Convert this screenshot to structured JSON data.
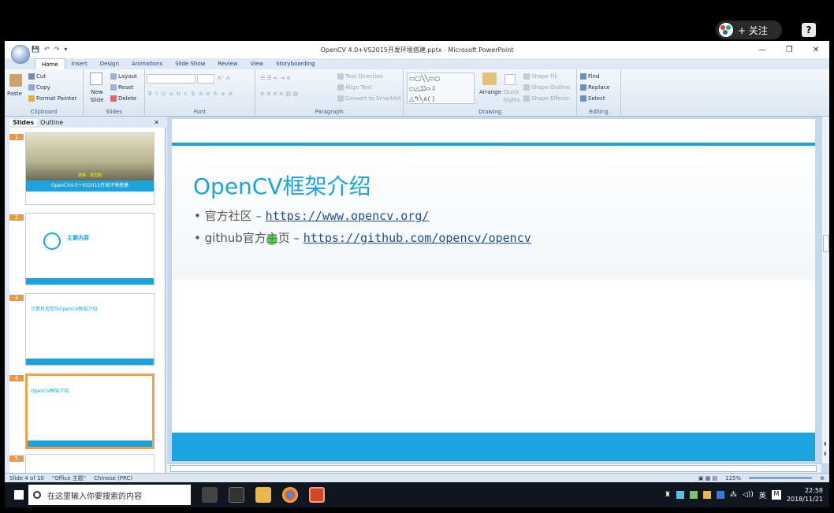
{
  "overlay": {
    "follow_label": "+ 关注",
    "help_label": "?"
  },
  "window": {
    "title": "OpenCV 4.0+VS2015开发环境搭建.pptx - Microsoft PowerPoint",
    "qat": [
      "💾",
      "↶",
      "↷",
      "▾"
    ],
    "min": "—",
    "max": "❐",
    "close": "✕"
  },
  "tabs": [
    "Home",
    "Insert",
    "Design",
    "Animations",
    "Slide Show",
    "Review",
    "View",
    "Storyboarding"
  ],
  "ribbon": {
    "clipboard": {
      "label": "Clipboard",
      "paste": "Paste",
      "cut": "Cut",
      "copy": "Copy",
      "format_painter": "Format Painter"
    },
    "slides": {
      "label": "Slides",
      "new_slide": "New Slide",
      "layout": "Layout",
      "reset": "Reset",
      "delete": "Delete"
    },
    "font": {
      "label": "Font",
      "buttons": [
        "B",
        "I",
        "U",
        "abc",
        "S",
        "AV",
        "Aa",
        "A"
      ]
    },
    "paragraph": {
      "label": "Paragraph",
      "text_direction": "Text Direction",
      "align_text": "Align Text",
      "convert_smartart": "Convert to SmartArt"
    },
    "drawing": {
      "label": "Drawing",
      "arrange": "Arrange",
      "quick_styles": "Quick Styles",
      "shape_fill": "Shape Fill",
      "shape_outline": "Shape Outline",
      "shape_effects": "Shape Effects"
    },
    "editing": {
      "label": "Editing",
      "find": "Find",
      "replace": "Replace",
      "select": "Select"
    }
  },
  "slidepane": {
    "tab_slides": "Slides",
    "tab_outline": "Outline",
    "close": "✕",
    "thumbs": [
      {
        "num": "1",
        "text": "OpenCV4.0+VS2015开发环境搭建",
        "sub": "讲师：贾志刚"
      },
      {
        "num": "2",
        "text": "主要内容"
      },
      {
        "num": "3",
        "text": "计算机视觉与OpenCV框架介绍"
      },
      {
        "num": "4",
        "text": "OpenCV框架介绍"
      },
      {
        "num": "5",
        "text": ""
      }
    ]
  },
  "slide": {
    "title": "OpenCV框架介绍",
    "bullets": [
      {
        "label": "官方社区 – ",
        "link": "https://www.opencv.org/"
      },
      {
        "label": "github官方主页 – ",
        "link": "https://github.com/opencv/opencv"
      }
    ],
    "accent": "#1aa3dc"
  },
  "status": {
    "slide": "Slide 4 of 10",
    "theme": "\"Office 主题\"",
    "language": "Chinese (PRC)",
    "zoom": "125%"
  },
  "taskbar": {
    "search": "在这里输入你要搜索的内容",
    "time": "22:58",
    "date": "2018/11/21",
    "ime": "英"
  }
}
